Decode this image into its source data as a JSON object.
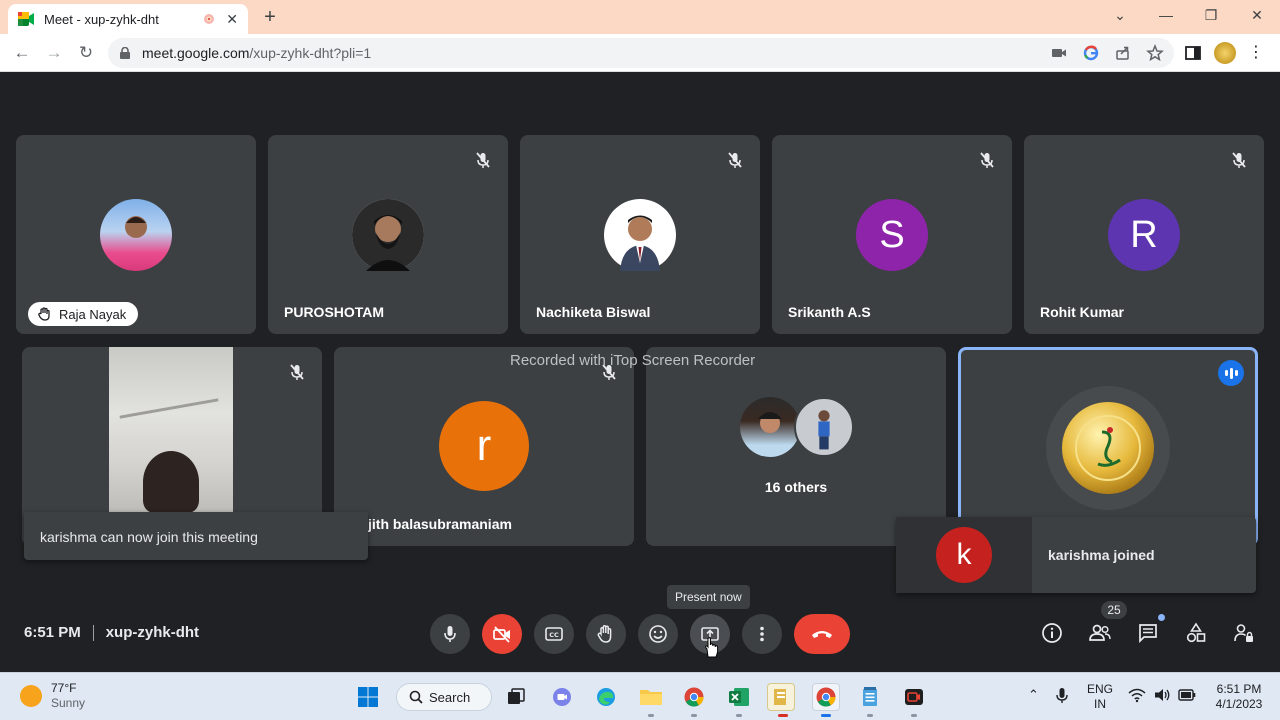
{
  "browser": {
    "tab_title": "Meet - xup-zyhk-dht",
    "url_host": "meet.google.com",
    "url_path": "/xup-zyhk-dht?pli=1"
  },
  "meeting": {
    "watermark": "Recorded with iTop Screen Recorder",
    "participants_top": [
      {
        "name": "Raja Nayak",
        "hand_raised": true
      },
      {
        "name": "PUROSHOTAM"
      },
      {
        "name": "Nachiketa Biswal"
      },
      {
        "name": "Srikanth A.S",
        "initial": "S",
        "color": "#8e24aa"
      },
      {
        "name": "Rohit Kumar",
        "initial": "R",
        "color": "#5e35b1"
      }
    ],
    "tile_2_1_name": "jith balasubramaniam",
    "tile_2_1_initial": "r",
    "tile_2_1_color": "#e8710a",
    "others_label": "16 others",
    "toast_left": "karishma can now join this meeting",
    "toast_right": "karishma joined",
    "toast_right_initial": "k",
    "toast_right_color": "#c5221f"
  },
  "bottom_bar": {
    "time": "6:51 PM",
    "meeting_code": "xup-zyhk-dht",
    "tooltip": "Present now",
    "people_count": "25",
    "accent_red": "#ea4335"
  },
  "taskbar": {
    "temp": "77°F",
    "condition": "Sunny",
    "search_label": "Search",
    "lang_line1": "ENG",
    "lang_line2": "IN",
    "clock_time": "6:51 PM",
    "clock_date": "4/1/2023"
  }
}
